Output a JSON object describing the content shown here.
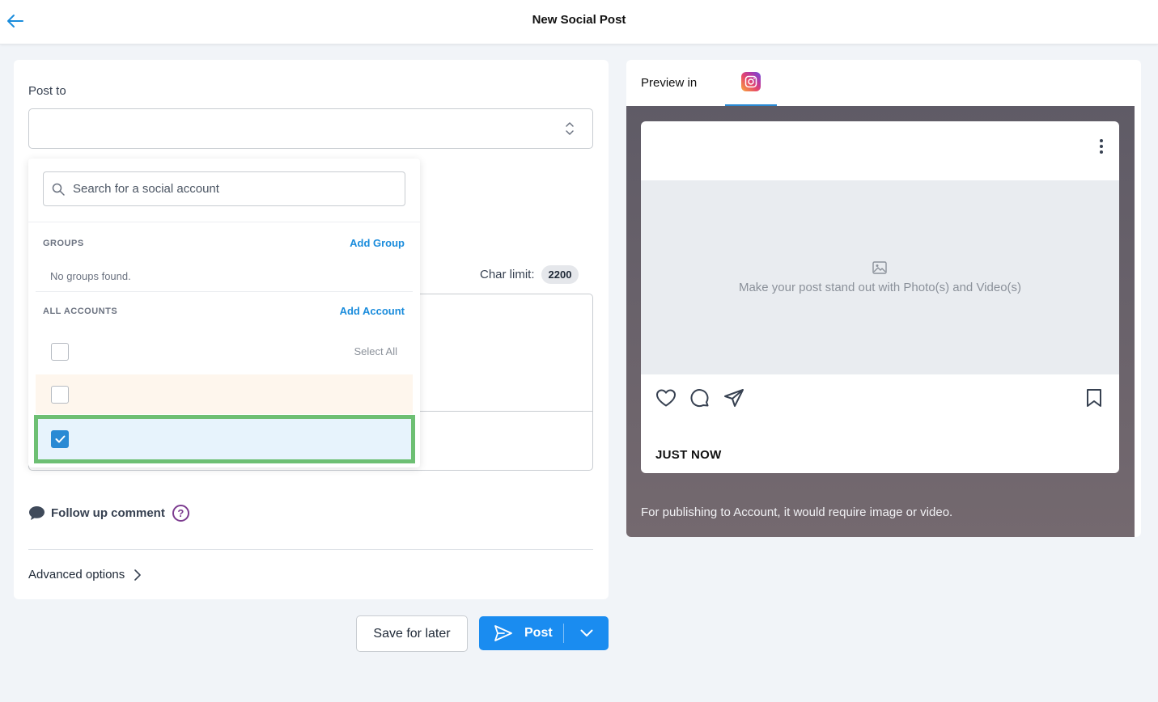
{
  "header": {
    "title": "New Social Post"
  },
  "compose": {
    "post_to_label": "Post to",
    "char_limit_label": "Char limit:",
    "char_limit_value": "2200",
    "followup_label": "Follow up comment",
    "advanced_label": "Advanced options"
  },
  "dropdown": {
    "search_placeholder": "Search for a social account",
    "groups_title": "GROUPS",
    "add_group": "Add Group",
    "no_groups": "No groups found.",
    "accounts_title": "ALL ACCOUNTS",
    "add_account": "Add Account",
    "select_all": "Select All",
    "rows": [
      {
        "checked": false,
        "state": "hover"
      },
      {
        "checked": true,
        "state": "selected"
      }
    ]
  },
  "preview": {
    "label": "Preview in",
    "network": "instagram-icon",
    "media_text": "Make your post stand out with Photo(s) and Video(s)",
    "timestamp": "JUST NOW",
    "note": "For publishing to Account, it would require image or video."
  },
  "footer": {
    "save_label": "Save for later",
    "post_label": "Post"
  },
  "colors": {
    "accent": "#1a8cf0",
    "highlight": "#6dbf73",
    "help": "#7c3b8f"
  }
}
